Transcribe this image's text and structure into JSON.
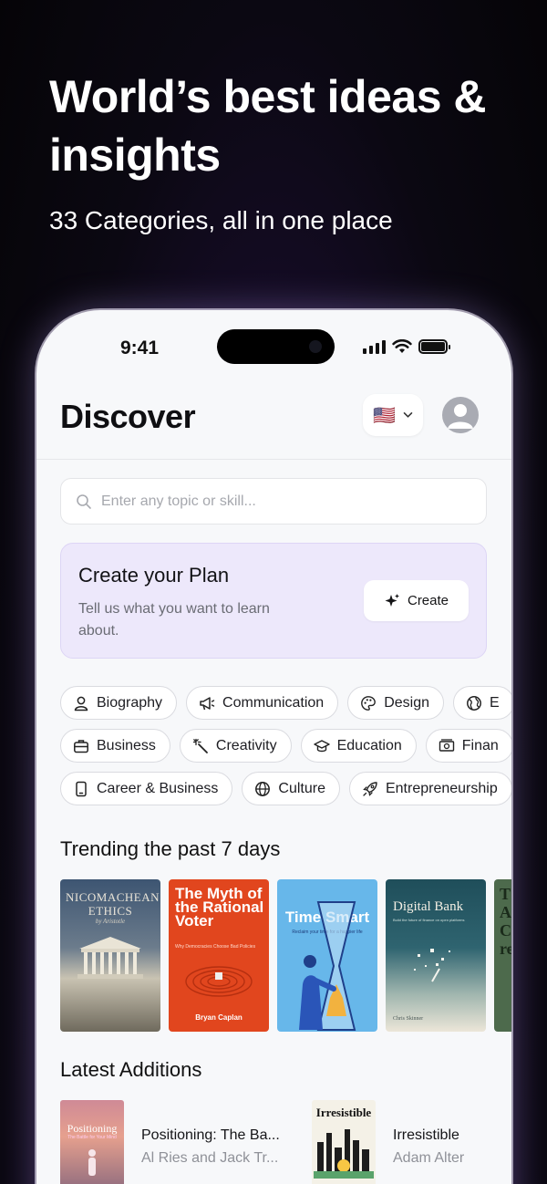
{
  "hero": {
    "title": "World’s best ideas & insights",
    "subtitle": "33 Categories, all in one place"
  },
  "status_bar": {
    "time": "9:41"
  },
  "header": {
    "title": "Discover",
    "language_flag": "🇺🇸"
  },
  "search": {
    "placeholder": "Enter any topic or skill..."
  },
  "plan_card": {
    "title": "Create your Plan",
    "description": "Tell us what you want to learn about.",
    "button_label": "Create"
  },
  "categories": {
    "row1": [
      {
        "label": "Biography",
        "icon": "person-icon"
      },
      {
        "label": "Communication",
        "icon": "megaphone-icon"
      },
      {
        "label": "Design",
        "icon": "palette-icon"
      },
      {
        "label": "E",
        "icon": "globe-icon"
      }
    ],
    "row2": [
      {
        "label": "Business",
        "icon": "briefcase-icon"
      },
      {
        "label": "Creativity",
        "icon": "magic-wand-icon"
      },
      {
        "label": "Education",
        "icon": "graduation-cap-icon"
      },
      {
        "label": "Finan",
        "icon": "banknote-icon"
      }
    ],
    "row3": [
      {
        "label": "Career & Business",
        "icon": "phone-icon"
      },
      {
        "label": "Culture",
        "icon": "globe-icon"
      },
      {
        "label": "Entrepreneurship",
        "icon": "rocket-icon"
      }
    ]
  },
  "trending": {
    "title": "Trending the past 7 days",
    "books": [
      {
        "title": "NICOMACHEAN ETHICS",
        "author": "by Aristotle",
        "color": "#4a5d74"
      },
      {
        "title": "The Myth of the Rational Voter",
        "subtitle": "Why Democracies Choose Bad Policies",
        "author": "Bryan Caplan",
        "color": "#e0451f"
      },
      {
        "title": "Time Smart",
        "subtitle": "Reclaim your time for a happier life",
        "color": "#67b7ea"
      },
      {
        "title": "Digital Bank",
        "subtitle": "Build the future of finance on open platforms",
        "author": "Chris Skinner",
        "color": "#2a5560"
      },
      {
        "title": "T A C re",
        "color": "#4d6a4c"
      }
    ]
  },
  "latest": {
    "title": "Latest Additions",
    "items": [
      {
        "title": "Positioning: The Ba...",
        "author": "Al Ries and Jack Tr...",
        "cover_title": "Positioning",
        "cover_subtitle": "The Battle for Your Mind"
      },
      {
        "title": "Irresistible",
        "author": "Adam Alter",
        "cover_title": "Irresistible"
      }
    ]
  }
}
